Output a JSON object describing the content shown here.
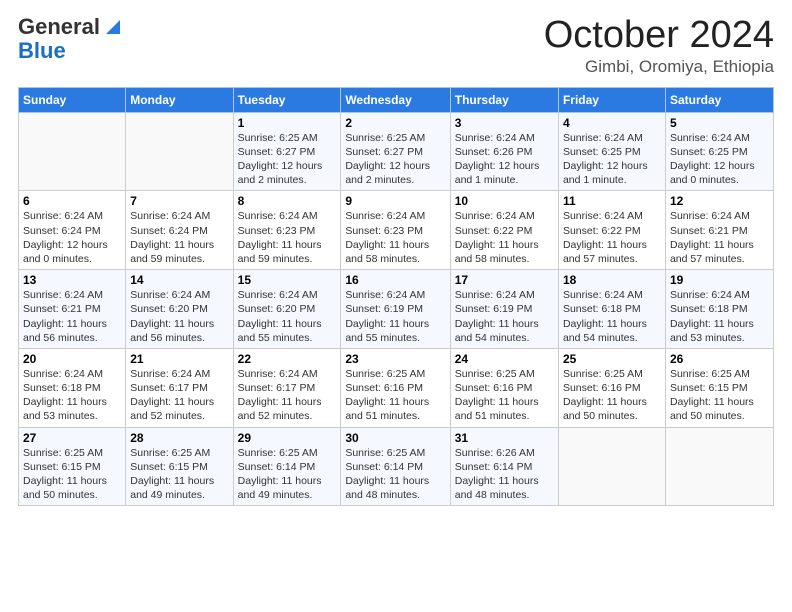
{
  "header": {
    "logo_general": "General",
    "logo_blue": "Blue",
    "month_title": "October 2024",
    "location": "Gimbi, Oromiya, Ethiopia"
  },
  "days_of_week": [
    "Sunday",
    "Monday",
    "Tuesday",
    "Wednesday",
    "Thursday",
    "Friday",
    "Saturday"
  ],
  "weeks": [
    [
      {
        "day": "",
        "sunrise": "",
        "sunset": "",
        "daylight": ""
      },
      {
        "day": "",
        "sunrise": "",
        "sunset": "",
        "daylight": ""
      },
      {
        "day": "1",
        "sunrise": "Sunrise: 6:25 AM",
        "sunset": "Sunset: 6:27 PM",
        "daylight": "Daylight: 12 hours and 2 minutes."
      },
      {
        "day": "2",
        "sunrise": "Sunrise: 6:25 AM",
        "sunset": "Sunset: 6:27 PM",
        "daylight": "Daylight: 12 hours and 2 minutes."
      },
      {
        "day": "3",
        "sunrise": "Sunrise: 6:24 AM",
        "sunset": "Sunset: 6:26 PM",
        "daylight": "Daylight: 12 hours and 1 minute."
      },
      {
        "day": "4",
        "sunrise": "Sunrise: 6:24 AM",
        "sunset": "Sunset: 6:25 PM",
        "daylight": "Daylight: 12 hours and 1 minute."
      },
      {
        "day": "5",
        "sunrise": "Sunrise: 6:24 AM",
        "sunset": "Sunset: 6:25 PM",
        "daylight": "Daylight: 12 hours and 0 minutes."
      }
    ],
    [
      {
        "day": "6",
        "sunrise": "Sunrise: 6:24 AM",
        "sunset": "Sunset: 6:24 PM",
        "daylight": "Daylight: 12 hours and 0 minutes."
      },
      {
        "day": "7",
        "sunrise": "Sunrise: 6:24 AM",
        "sunset": "Sunset: 6:24 PM",
        "daylight": "Daylight: 11 hours and 59 minutes."
      },
      {
        "day": "8",
        "sunrise": "Sunrise: 6:24 AM",
        "sunset": "Sunset: 6:23 PM",
        "daylight": "Daylight: 11 hours and 59 minutes."
      },
      {
        "day": "9",
        "sunrise": "Sunrise: 6:24 AM",
        "sunset": "Sunset: 6:23 PM",
        "daylight": "Daylight: 11 hours and 58 minutes."
      },
      {
        "day": "10",
        "sunrise": "Sunrise: 6:24 AM",
        "sunset": "Sunset: 6:22 PM",
        "daylight": "Daylight: 11 hours and 58 minutes."
      },
      {
        "day": "11",
        "sunrise": "Sunrise: 6:24 AM",
        "sunset": "Sunset: 6:22 PM",
        "daylight": "Daylight: 11 hours and 57 minutes."
      },
      {
        "day": "12",
        "sunrise": "Sunrise: 6:24 AM",
        "sunset": "Sunset: 6:21 PM",
        "daylight": "Daylight: 11 hours and 57 minutes."
      }
    ],
    [
      {
        "day": "13",
        "sunrise": "Sunrise: 6:24 AM",
        "sunset": "Sunset: 6:21 PM",
        "daylight": "Daylight: 11 hours and 56 minutes."
      },
      {
        "day": "14",
        "sunrise": "Sunrise: 6:24 AM",
        "sunset": "Sunset: 6:20 PM",
        "daylight": "Daylight: 11 hours and 56 minutes."
      },
      {
        "day": "15",
        "sunrise": "Sunrise: 6:24 AM",
        "sunset": "Sunset: 6:20 PM",
        "daylight": "Daylight: 11 hours and 55 minutes."
      },
      {
        "day": "16",
        "sunrise": "Sunrise: 6:24 AM",
        "sunset": "Sunset: 6:19 PM",
        "daylight": "Daylight: 11 hours and 55 minutes."
      },
      {
        "day": "17",
        "sunrise": "Sunrise: 6:24 AM",
        "sunset": "Sunset: 6:19 PM",
        "daylight": "Daylight: 11 hours and 54 minutes."
      },
      {
        "day": "18",
        "sunrise": "Sunrise: 6:24 AM",
        "sunset": "Sunset: 6:18 PM",
        "daylight": "Daylight: 11 hours and 54 minutes."
      },
      {
        "day": "19",
        "sunrise": "Sunrise: 6:24 AM",
        "sunset": "Sunset: 6:18 PM",
        "daylight": "Daylight: 11 hours and 53 minutes."
      }
    ],
    [
      {
        "day": "20",
        "sunrise": "Sunrise: 6:24 AM",
        "sunset": "Sunset: 6:18 PM",
        "daylight": "Daylight: 11 hours and 53 minutes."
      },
      {
        "day": "21",
        "sunrise": "Sunrise: 6:24 AM",
        "sunset": "Sunset: 6:17 PM",
        "daylight": "Daylight: 11 hours and 52 minutes."
      },
      {
        "day": "22",
        "sunrise": "Sunrise: 6:24 AM",
        "sunset": "Sunset: 6:17 PM",
        "daylight": "Daylight: 11 hours and 52 minutes."
      },
      {
        "day": "23",
        "sunrise": "Sunrise: 6:25 AM",
        "sunset": "Sunset: 6:16 PM",
        "daylight": "Daylight: 11 hours and 51 minutes."
      },
      {
        "day": "24",
        "sunrise": "Sunrise: 6:25 AM",
        "sunset": "Sunset: 6:16 PM",
        "daylight": "Daylight: 11 hours and 51 minutes."
      },
      {
        "day": "25",
        "sunrise": "Sunrise: 6:25 AM",
        "sunset": "Sunset: 6:16 PM",
        "daylight": "Daylight: 11 hours and 50 minutes."
      },
      {
        "day": "26",
        "sunrise": "Sunrise: 6:25 AM",
        "sunset": "Sunset: 6:15 PM",
        "daylight": "Daylight: 11 hours and 50 minutes."
      }
    ],
    [
      {
        "day": "27",
        "sunrise": "Sunrise: 6:25 AM",
        "sunset": "Sunset: 6:15 PM",
        "daylight": "Daylight: 11 hours and 50 minutes."
      },
      {
        "day": "28",
        "sunrise": "Sunrise: 6:25 AM",
        "sunset": "Sunset: 6:15 PM",
        "daylight": "Daylight: 11 hours and 49 minutes."
      },
      {
        "day": "29",
        "sunrise": "Sunrise: 6:25 AM",
        "sunset": "Sunset: 6:14 PM",
        "daylight": "Daylight: 11 hours and 49 minutes."
      },
      {
        "day": "30",
        "sunrise": "Sunrise: 6:25 AM",
        "sunset": "Sunset: 6:14 PM",
        "daylight": "Daylight: 11 hours and 48 minutes."
      },
      {
        "day": "31",
        "sunrise": "Sunrise: 6:26 AM",
        "sunset": "Sunset: 6:14 PM",
        "daylight": "Daylight: 11 hours and 48 minutes."
      },
      {
        "day": "",
        "sunrise": "",
        "sunset": "",
        "daylight": ""
      },
      {
        "day": "",
        "sunrise": "",
        "sunset": "",
        "daylight": ""
      }
    ]
  ]
}
